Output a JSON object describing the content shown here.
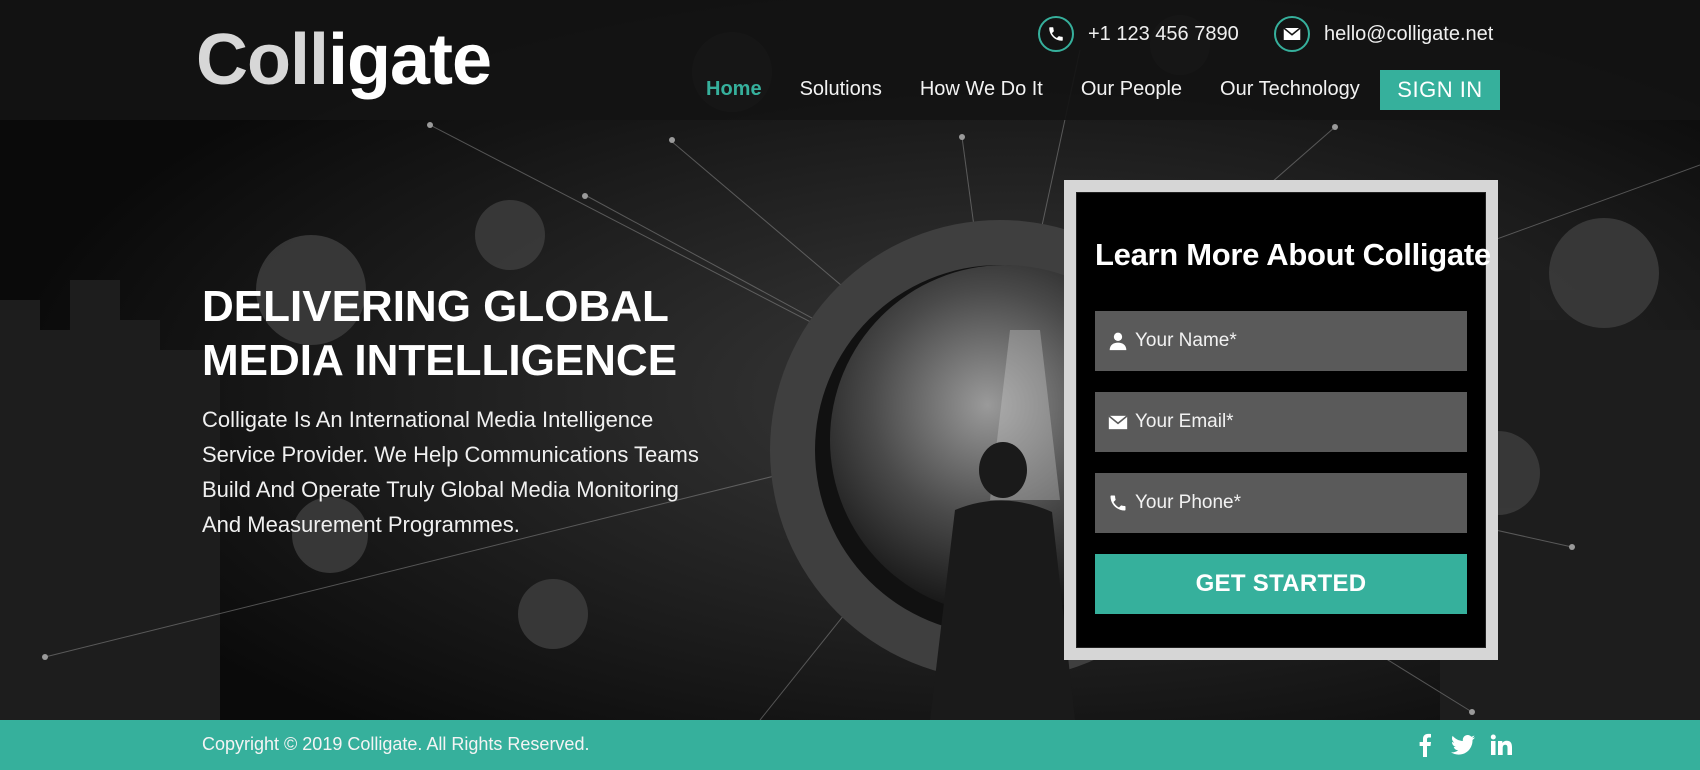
{
  "brand": {
    "logo_part_a": "Coll",
    "logo_part_b": "igate"
  },
  "header": {
    "phone": "+1 123 456 7890",
    "email": "hello@colligate.net",
    "nav": [
      {
        "label": "Home",
        "active": true
      },
      {
        "label": "Solutions",
        "active": false
      },
      {
        "label": "How We Do It",
        "active": false
      },
      {
        "label": "Our People",
        "active": false
      },
      {
        "label": "Our Technology",
        "active": false
      }
    ],
    "signin_label": "SIGN IN"
  },
  "hero": {
    "title_line1": "DELIVERING GLOBAL",
    "title_line2": "MEDIA INTELLIGENCE",
    "subtitle": "Colligate Is An International Media Intelligence Service Provider. We Help Communications Teams Build And Operate Truly Global Media Monitoring And Measurement Programmes."
  },
  "form": {
    "title": "Learn More About Colligate",
    "name_placeholder": "Your Name*",
    "email_placeholder": "Your Email*",
    "phone_placeholder": "Your Phone*",
    "submit_label": "GET STARTED"
  },
  "footer": {
    "copyright": "Copyright © 2019 Colligate. All Rights Reserved.",
    "social": [
      "facebook-icon",
      "twitter-icon",
      "linkedin-icon"
    ]
  },
  "colors": {
    "accent": "#36b09c",
    "header_bg": "#141414",
    "form_frame": "#d6d6d6",
    "input_bg": "#5a5a5a"
  }
}
